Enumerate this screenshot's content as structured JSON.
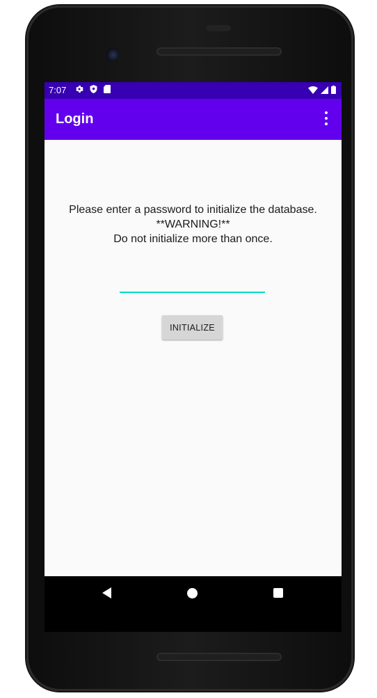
{
  "status_bar": {
    "time": "7:07",
    "left_icons": [
      "gear-icon",
      "shield-icon",
      "sd-card-icon"
    ],
    "right_icons": [
      "wifi-icon",
      "signal-icon",
      "battery-icon"
    ]
  },
  "app_bar": {
    "title": "Login",
    "menu_icon": "more-vert-icon"
  },
  "main": {
    "message_lines": [
      "Please enter a password to initialize the database.",
      "**WARNING!**",
      "Do not initialize more than once."
    ],
    "password": {
      "value": "",
      "placeholder": ""
    },
    "initialize_label": "INITIALIZE"
  },
  "nav_bar": {
    "icons": [
      "back-icon",
      "home-icon",
      "recents-icon"
    ]
  },
  "colors": {
    "status_bar": "#3700b3",
    "app_bar": "#6200ee",
    "input_underline": "#03dac5",
    "background": "#fafafa",
    "button": "#d6d6d6"
  }
}
